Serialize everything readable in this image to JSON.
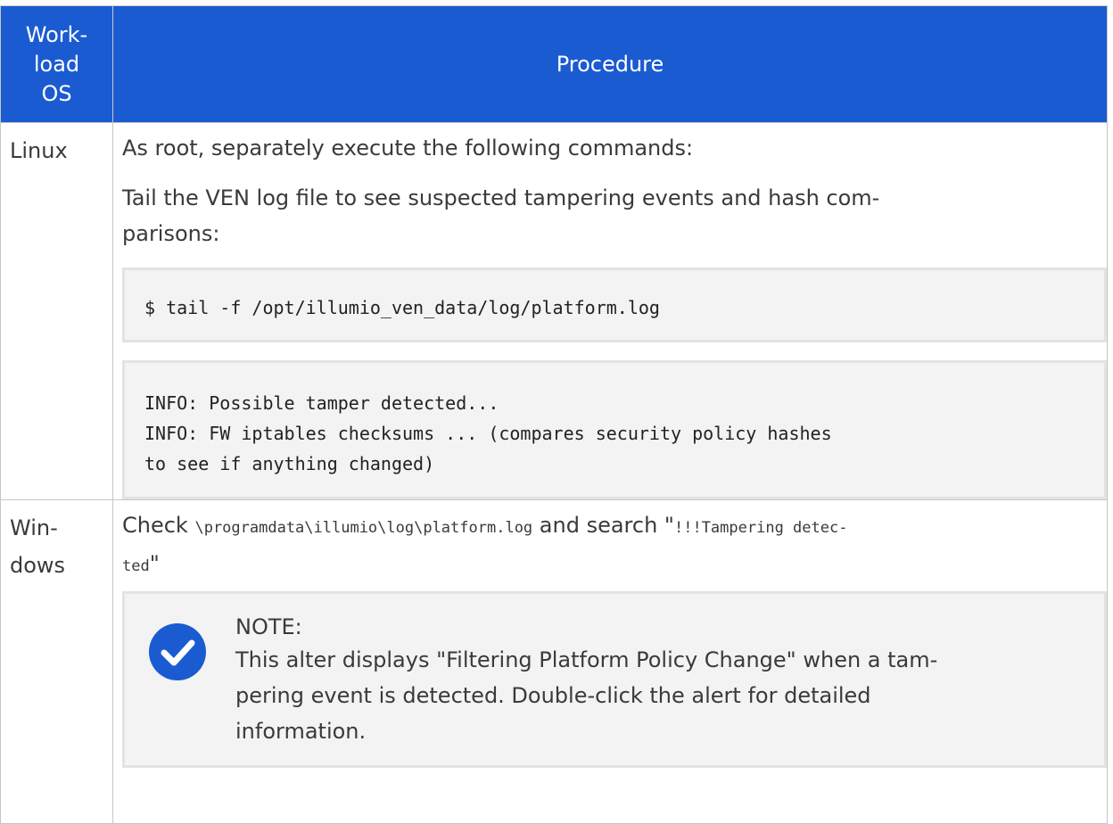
{
  "table": {
    "headers": {
      "os_line1": "Work-",
      "os_line2": "load",
      "os_line3": "OS",
      "procedure": "Procedure"
    },
    "rows": [
      {
        "os": "Linux",
        "intro": "As root, separately execute the following commands:",
        "tail_text": "Tail the VEN log file to see suspected tampering events and hash com-parisons:",
        "tail_line1": "Tail the VEN log file to see suspected tampering events and hash com-",
        "tail_line2": "parisons:",
        "command": "$ tail -f /opt/illumio_ven_data/log/platform.log",
        "output_lines": [
          "INFO: Possible tamper detected...",
          "INFO: FW iptables checksums ... (compares security policy hashes",
          "to see if anything changed)"
        ]
      },
      {
        "os_line1": "Win-",
        "os_line2": "dows",
        "check_prefix": "Check ",
        "check_path": "\\programdata\\illumio\\log\\platform.log",
        "check_mid": " and search \"",
        "check_search_part1": "!!!Tampering detec-",
        "check_search_part2": "ted",
        "check_suffix": "\"",
        "note": {
          "icon": "check-circle-icon",
          "title": "NOTE:",
          "text_line1": "This alter displays \"Filtering Platform Policy Change\" when a tam-",
          "text_line2": "pering event is detected. Double-click the alert for detailed",
          "text_line3": "information."
        }
      }
    ]
  },
  "colors": {
    "header_bg": "#1a5bd1",
    "note_icon": "#1a5bd1",
    "code_bg": "#f3f3f3"
  }
}
